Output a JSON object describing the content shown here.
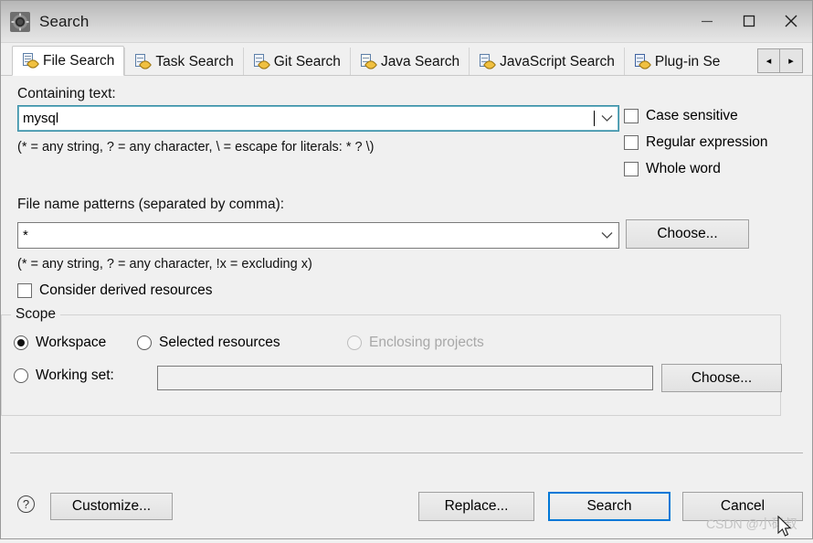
{
  "window": {
    "title": "Search",
    "icon": "search-app-icon",
    "controls": {
      "minimize": "–",
      "maximize": "☐",
      "close": "✕"
    }
  },
  "tabs": {
    "items": [
      {
        "label": "File Search",
        "icon": "file-search-icon",
        "active": true
      },
      {
        "label": "Task Search",
        "icon": "task-search-icon",
        "active": false
      },
      {
        "label": "Git Search",
        "icon": "git-search-icon",
        "active": false
      },
      {
        "label": "Java Search",
        "icon": "java-search-icon",
        "active": false
      },
      {
        "label": "JavaScript Search",
        "icon": "javascript-search-icon",
        "active": false
      },
      {
        "label": "Plug-in Se",
        "icon": "plugin-search-icon",
        "active": false
      }
    ],
    "scroll_left": "◂",
    "scroll_right": "▸"
  },
  "form": {
    "containing_text_label": "Containing text:",
    "containing_text_value": "mysql",
    "containing_text_hint": "(* = any string, ? = any character, \\ = escape for literals: * ? \\)",
    "options": [
      {
        "label": "Case sensitive",
        "checked": false
      },
      {
        "label": "Regular expression",
        "checked": false
      },
      {
        "label": "Whole word",
        "checked": false
      }
    ],
    "file_patterns_label": "File name patterns (separated by comma):",
    "file_patterns_value": "*",
    "file_patterns_hint": "(* = any string, ? = any character, !x = excluding x)",
    "choose_patterns_label": "Choose...",
    "consider_derived_label": "Consider derived resources",
    "consider_derived_checked": false,
    "dropdown_chevron": "⌄"
  },
  "scope": {
    "title": "Scope",
    "radios": [
      {
        "label": "Workspace",
        "checked": true,
        "disabled": false
      },
      {
        "label": "Selected resources",
        "checked": false,
        "disabled": false
      },
      {
        "label": "Enclosing projects",
        "checked": false,
        "disabled": true
      },
      {
        "label": "Working set:",
        "checked": false,
        "disabled": false
      }
    ],
    "working_set_value": "",
    "choose_working_set_label": "Choose..."
  },
  "footer": {
    "help_glyph": "?",
    "customize_label": "Customize...",
    "replace_label": "Replace...",
    "search_label": "Search",
    "cancel_label": "Cancel"
  },
  "watermark": {
    "text": "CSDN @小码叔"
  },
  "colors": {
    "accent": "#0078d7",
    "focus_field_border": "#3a8fa7",
    "window_bg": "#f0f0f0",
    "disabled_text": "#a8a8a8"
  }
}
